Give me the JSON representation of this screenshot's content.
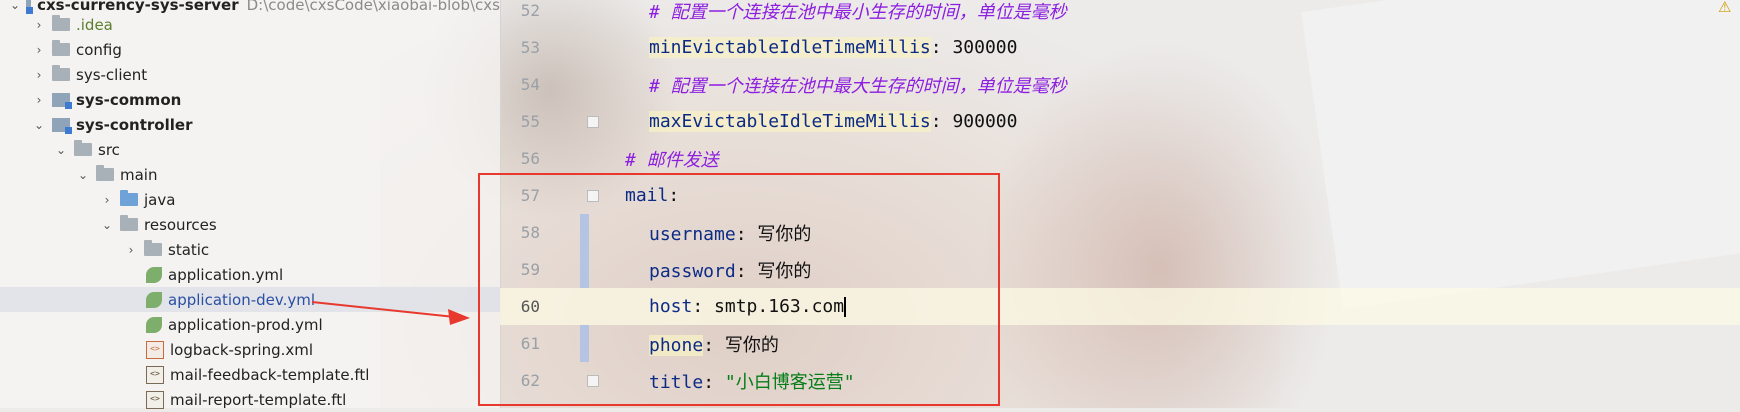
{
  "tree": {
    "root_label": "cxs-currency-sys-server",
    "root_path": "D:\\code\\cxsCode\\xiaobai-blob\\cxs",
    "items": [
      {
        "label": ".idea",
        "icon": "folder-icon"
      },
      {
        "label": "config",
        "icon": "folder-icon"
      },
      {
        "label": "sys-client",
        "icon": "folder-icon"
      },
      {
        "label": "sys-common",
        "icon": "module-folder-icon"
      },
      {
        "label": "sys-controller",
        "icon": "module-folder-icon"
      },
      {
        "label": "src",
        "icon": "folder-icon"
      },
      {
        "label": "main",
        "icon": "folder-icon"
      },
      {
        "label": "java",
        "icon": "source-folder-icon"
      },
      {
        "label": "resources",
        "icon": "resources-folder-icon"
      },
      {
        "label": "static",
        "icon": "folder-icon"
      },
      {
        "label": "application.yml",
        "icon": "yaml-file-icon"
      },
      {
        "label": "application-dev.yml",
        "icon": "yaml-file-icon"
      },
      {
        "label": "application-prod.yml",
        "icon": "yaml-file-icon"
      },
      {
        "label": "logback-spring.xml",
        "icon": "xml-file-icon"
      },
      {
        "label": "mail-feedback-template.ftl",
        "icon": "ftl-file-icon"
      },
      {
        "label": "mail-report-template.ftl",
        "icon": "ftl-file-icon"
      }
    ]
  },
  "editor": {
    "lines": [
      {
        "num": "52",
        "comment": "# 配置一个连接在池中最小生存的时间，单位是毫秒"
      },
      {
        "num": "53",
        "key": "minEvictableIdleTimeMillis",
        "sep": ": ",
        "value": "300000"
      },
      {
        "num": "54",
        "comment": "# 配置一个连接在池中最大生存的时间，单位是毫秒"
      },
      {
        "num": "55",
        "key": "maxEvictableIdleTimeMillis",
        "sep": ": ",
        "value": "900000"
      },
      {
        "num": "56",
        "comment": "# 邮件发送"
      },
      {
        "num": "57",
        "key": "mail",
        "sep": ":"
      },
      {
        "num": "58",
        "key": "username",
        "sep": ": ",
        "value": "写你的"
      },
      {
        "num": "59",
        "key": "password",
        "sep": ": ",
        "value": "写你的"
      },
      {
        "num": "60",
        "key": "host",
        "sep": ": ",
        "value": "smtp.163.com"
      },
      {
        "num": "61",
        "key": "phone",
        "sep": ": ",
        "value": "写你的"
      },
      {
        "num": "62",
        "key": "title",
        "sep": ": ",
        "value": "\"小白博客运营\""
      }
    ]
  },
  "colors": {
    "annotation": "#e8392f",
    "comment": "#8c1ee0",
    "key": "#0c2b86",
    "string": "#067d17"
  }
}
